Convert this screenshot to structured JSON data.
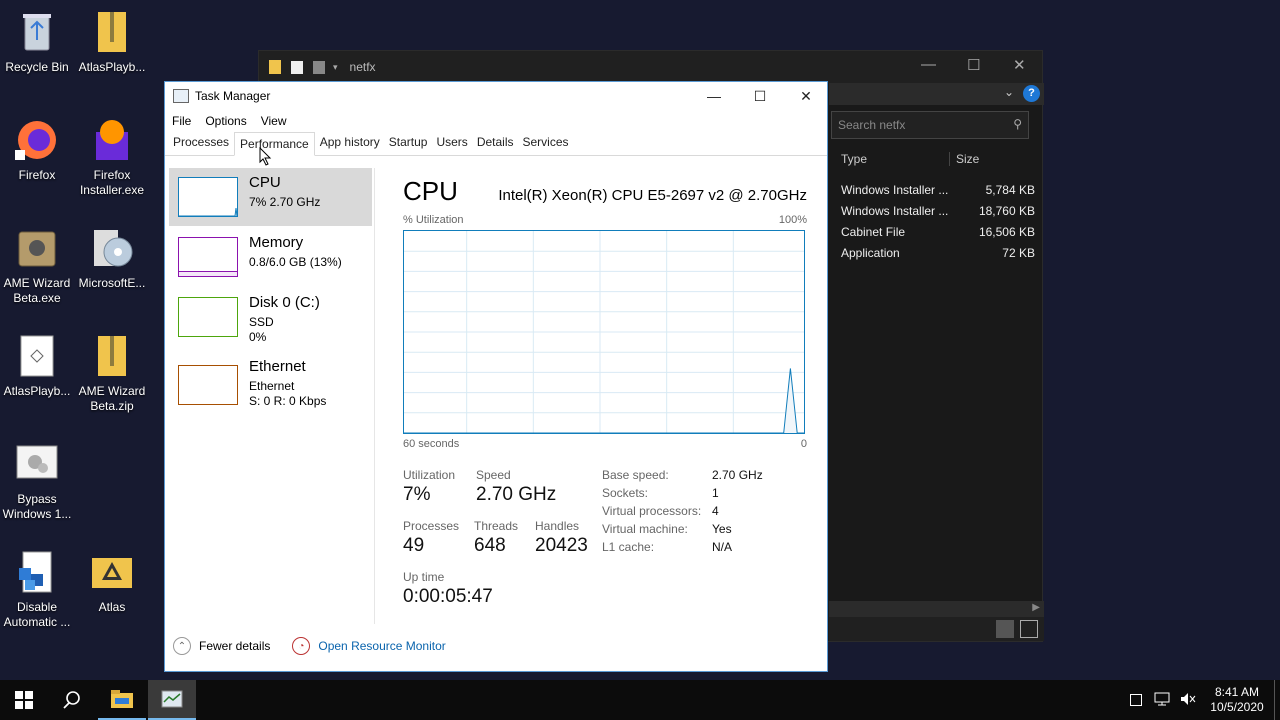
{
  "desktop": {
    "icons": [
      {
        "label": "Recycle Bin"
      },
      {
        "label": "AtlasPlayb..."
      },
      {
        "label": "Firefox"
      },
      {
        "label": "Firefox Installer.exe"
      },
      {
        "label": "AME Wizard Beta.exe"
      },
      {
        "label": "MicrosoftE..."
      },
      {
        "label": "AtlasPlayb..."
      },
      {
        "label": "AME Wizard Beta.zip"
      },
      {
        "label": "Bypass Windows 1..."
      },
      {
        "label": "Disable Automatic ..."
      },
      {
        "label": "Atlas"
      }
    ]
  },
  "explorer": {
    "title": "netfx",
    "search_placeholder": "Search netfx",
    "columns": {
      "type": "Type",
      "size": "Size"
    },
    "rows": [
      {
        "type": "Windows Installer ...",
        "size": "5,784 KB"
      },
      {
        "type": "Windows Installer ...",
        "size": "18,760 KB"
      },
      {
        "type": "Cabinet File",
        "size": "16,506 KB"
      },
      {
        "type": "Application",
        "size": "72 KB"
      }
    ]
  },
  "taskmanager": {
    "title": "Task Manager",
    "menu": [
      "File",
      "Options",
      "View"
    ],
    "tabs": [
      "Processes",
      "Performance",
      "App history",
      "Startup",
      "Users",
      "Details",
      "Services"
    ],
    "active_tab": "Performance",
    "resources": [
      {
        "name": "CPU",
        "line1": "7%  2.70 GHz",
        "line2": "",
        "color": "#117dbb"
      },
      {
        "name": "Memory",
        "line1": "0.8/6.0 GB (13%)",
        "line2": "",
        "color": "#8b12ae"
      },
      {
        "name": "Disk 0 (C:)",
        "line1": "SSD",
        "line2": "0%",
        "color": "#4da60c"
      },
      {
        "name": "Ethernet",
        "line1": "Ethernet",
        "line2": "S: 0  R: 0 Kbps",
        "color": "#a74f01"
      }
    ],
    "cpu": {
      "title": "CPU",
      "model": "Intel(R) Xeon(R) CPU E5-2697 v2 @ 2.70GHz",
      "utilization_axis_label": "% Utilization",
      "max_label": "100%",
      "time_label": "60 seconds",
      "zero_label": "0",
      "stats": {
        "utilization_label": "Utilization",
        "utilization": "7%",
        "speed_label": "Speed",
        "speed": "2.70 GHz",
        "processes_label": "Processes",
        "processes": "49",
        "threads_label": "Threads",
        "threads": "648",
        "handles_label": "Handles",
        "handles": "20423",
        "uptime_label": "Up time",
        "uptime": "0:00:05:47"
      },
      "details": [
        {
          "key": "Base speed:",
          "value": "2.70 GHz"
        },
        {
          "key": "Sockets:",
          "value": "1"
        },
        {
          "key": "Virtual processors:",
          "value": "4"
        },
        {
          "key": "Virtual machine:",
          "value": "Yes"
        },
        {
          "key": "L1 cache:",
          "value": "N/A"
        }
      ],
      "graph_history": [
        0,
        0,
        0,
        0,
        0,
        0,
        0,
        0,
        0,
        0,
        0,
        0,
        0,
        0,
        0,
        0,
        0,
        0,
        0,
        0,
        0,
        0,
        0,
        0,
        0,
        0,
        0,
        0,
        0,
        0,
        0,
        0,
        0,
        0,
        0,
        0,
        0,
        0,
        0,
        0,
        0,
        0,
        0,
        0,
        0,
        0,
        0,
        0,
        0,
        0,
        0,
        0,
        0,
        0,
        0,
        0,
        0,
        32,
        0,
        0
      ]
    },
    "footer": {
      "fewer_details": "Fewer details",
      "resource_monitor": "Open Resource Monitor"
    }
  },
  "taskbar": {
    "time": "8:41 AM",
    "date": "10/5/2020"
  }
}
